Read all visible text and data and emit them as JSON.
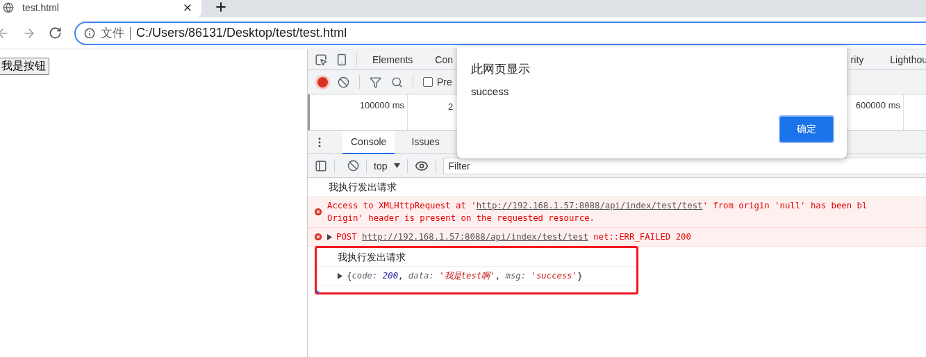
{
  "browser_tab": {
    "title": "test.html"
  },
  "address_bar": {
    "security_label": "文件",
    "url": "C:/Users/86131/Desktop/test/test.html"
  },
  "page": {
    "button": "我是按钮"
  },
  "devtools": {
    "panel_tabs": [
      {
        "label": "Elements",
        "selected": false
      },
      {
        "label": "Con",
        "selected": false
      },
      {
        "label": "rity",
        "selected": false
      },
      {
        "label": "Lighthou",
        "selected": false
      }
    ],
    "preserve_checkbox": {
      "label": "Pre",
      "checked": false
    },
    "timeline_ticks": [
      "100000 ms",
      "2",
      "600000 ms"
    ],
    "drawer_tabs": [
      {
        "label": "Console",
        "selected": true
      },
      {
        "label": "Issues",
        "selected": false
      }
    ],
    "console_toolbar": {
      "context": "top",
      "filter_placeholder": "Filter"
    },
    "messages": [
      {
        "kind": "log",
        "highlighted": false,
        "text": "我执行发出请求"
      },
      {
        "kind": "error",
        "highlighted": false,
        "before": "Access to XMLHttpRequest at '",
        "url": "http://192.168.1.57:8088/api/index/test/test",
        "after": "' from origin 'null' has been bl",
        "line2": "Origin' header is present on the requested resource."
      },
      {
        "kind": "request-error",
        "highlighted": false,
        "method": "POST",
        "url": "http://192.168.1.57:8088/api/index/test/test",
        "status": "net::ERR_FAILED 200"
      },
      {
        "kind": "log",
        "highlighted": true,
        "text": "我执行发出请求"
      },
      {
        "kind": "object",
        "highlighted": true,
        "tokens": [
          {
            "kind": "punct",
            "text": "{"
          },
          {
            "kind": "key",
            "text": "code: "
          },
          {
            "kind": "number",
            "text": "200"
          },
          {
            "kind": "punct",
            "text": ", "
          },
          {
            "kind": "key",
            "text": "data: "
          },
          {
            "kind": "string",
            "text": "'我是test啊'"
          },
          {
            "kind": "punct",
            "text": ", "
          },
          {
            "kind": "key",
            "text": "msg: "
          },
          {
            "kind": "string",
            "text": "'success'"
          },
          {
            "kind": "punct",
            "text": "}"
          }
        ]
      }
    ]
  },
  "dialog": {
    "title": "此网页显示",
    "message": "success",
    "ok_button": "确定"
  }
}
